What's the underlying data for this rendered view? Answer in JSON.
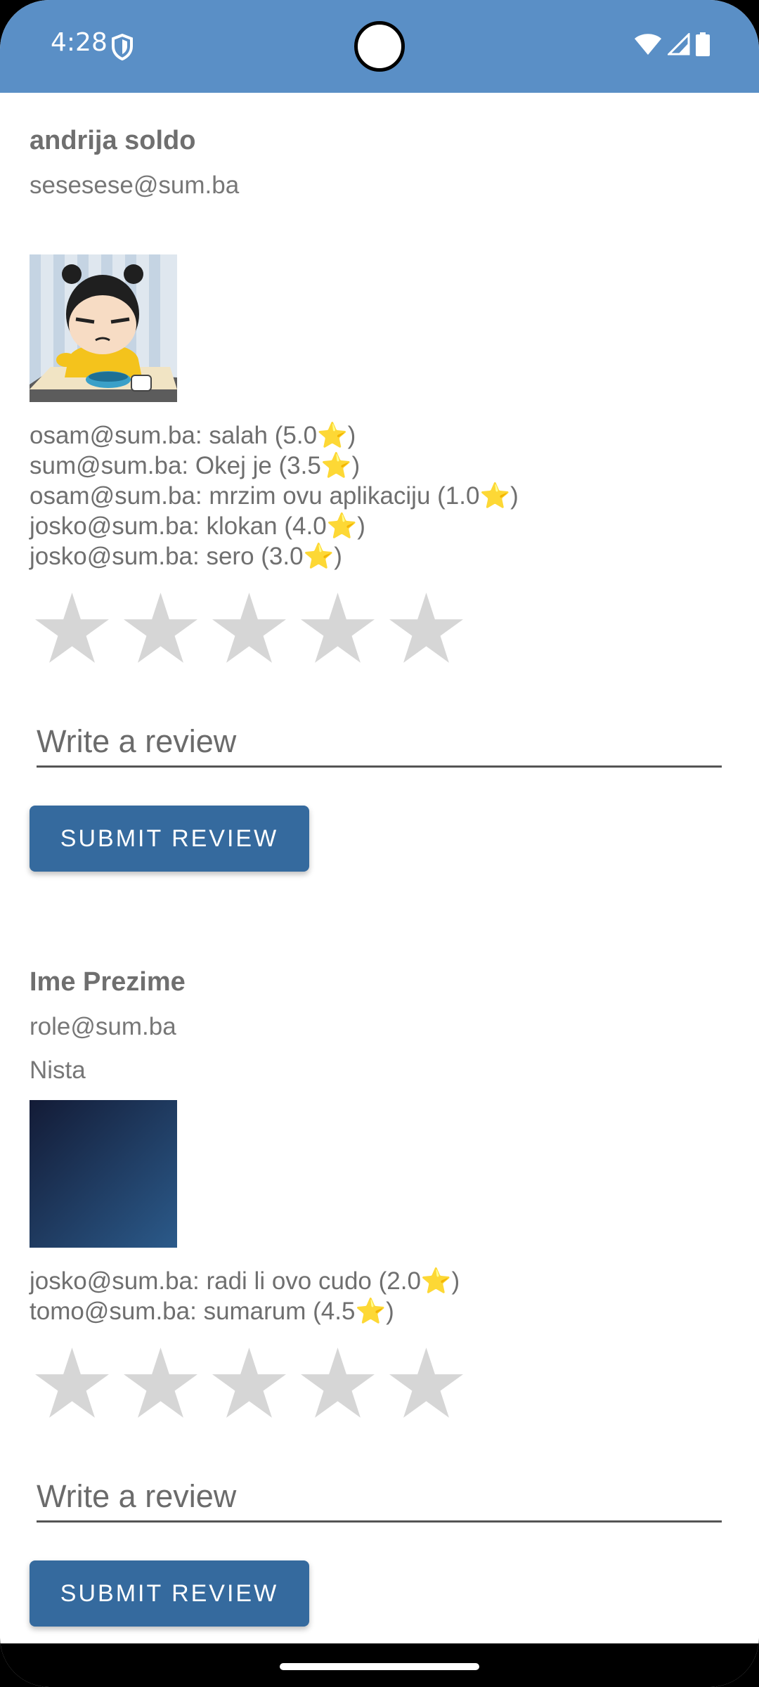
{
  "status_bar": {
    "time": "4:28",
    "background": "#5a8fc6"
  },
  "cards": [
    {
      "name": "andrija soldo",
      "email": "sesesese@sum.ba",
      "description": "",
      "image": "cartoon-avatar-image",
      "reviews": [
        {
          "text": "osam@sum.ba: salah (5.0",
          "star": "⭐",
          "close": ")"
        },
        {
          "text": "sum@sum.ba: Okej je (3.5",
          "star": "⭐",
          "close": ")"
        },
        {
          "text": "osam@sum.ba: mrzim ovu aplikaciju (1.0",
          "star": "⭐",
          "close": ")"
        },
        {
          "text": "josko@sum.ba: klokan (4.0",
          "star": "⭐",
          "close": ")"
        },
        {
          "text": "josko@sum.ba: sero (3.0",
          "star": "⭐",
          "close": ")"
        }
      ],
      "rating": 0,
      "rating_max": 5,
      "review_placeholder": "Write a review",
      "submit_label": "SUBMIT REVIEW"
    },
    {
      "name": "Ime Prezime",
      "email": "role@sum.ba",
      "description": "Nista",
      "image": "dark-blue-gradient-image",
      "reviews": [
        {
          "text": "josko@sum.ba: radi li ovo cudo (2.0",
          "star": "⭐",
          "close": ")"
        },
        {
          "text": "tomo@sum.ba: sumarum (4.5",
          "star": "⭐",
          "close": ")"
        }
      ],
      "rating": 0,
      "rating_max": 5,
      "review_placeholder": "Write a review",
      "submit_label": "SUBMIT REVIEW"
    }
  ],
  "colors": {
    "accent": "#356a9e",
    "star_empty": "#d6d6d6",
    "text": "#6f6f6f"
  }
}
